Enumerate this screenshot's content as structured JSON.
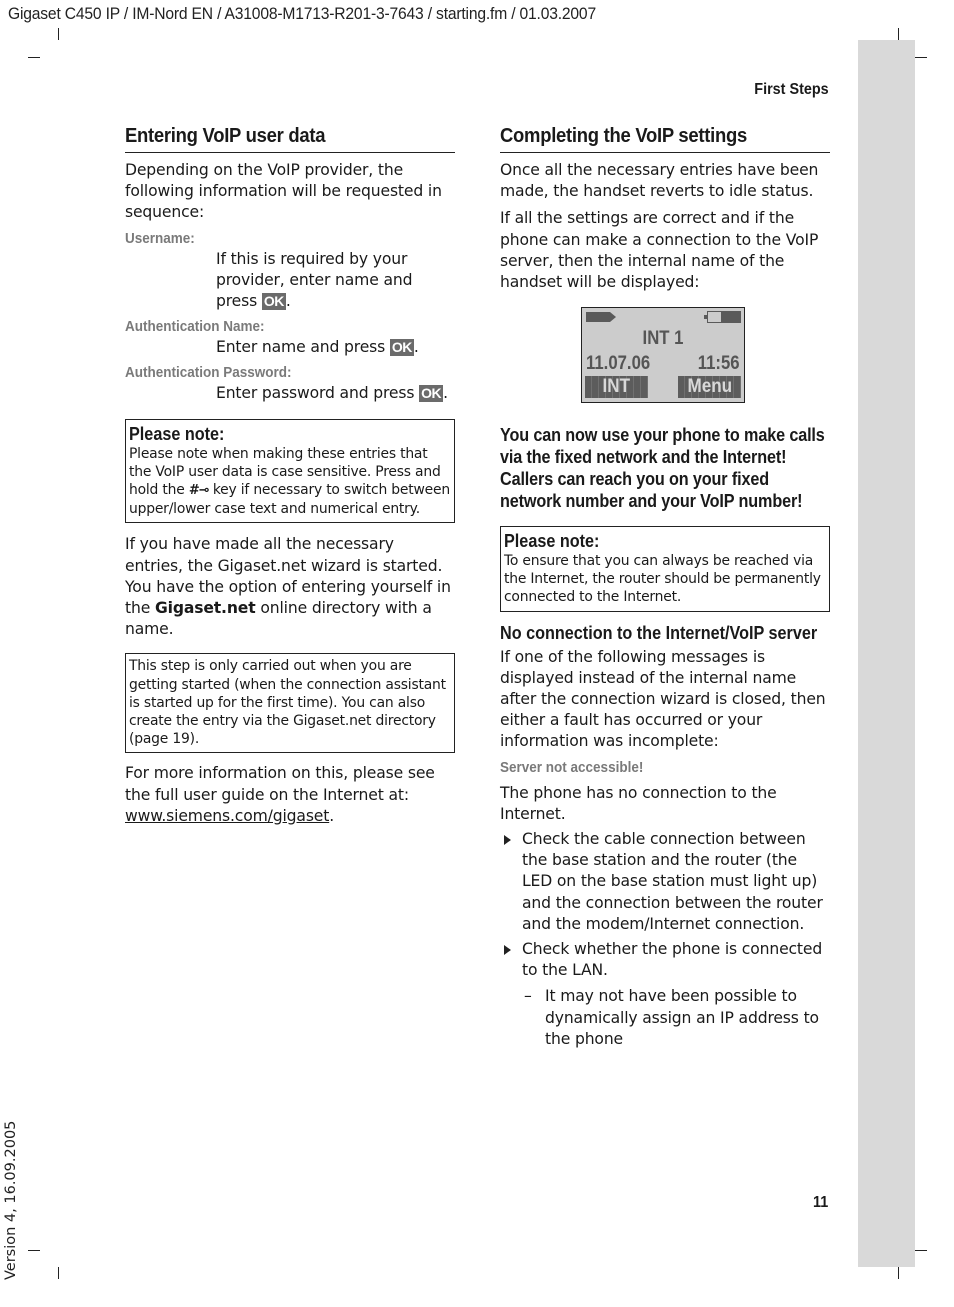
{
  "header": {
    "doc_line": "Gigaset C450 IP / IM-Nord EN / A31008-M1713-R201-3-7643 / starting.fm / 01.03.2007",
    "chapter": "First Steps"
  },
  "footer": {
    "page_number": "11",
    "version": "Version 4, 16.09.2005"
  },
  "left": {
    "title": "Entering VoIP user data",
    "intro": "Depending on the VoIP provider, the following information will be requested in sequence:",
    "entries": [
      {
        "label": "Username:",
        "text": "If this is required by your provider, enter name and press",
        "key": "OK"
      },
      {
        "label": "Authentication Name:",
        "text": "Enter name and press",
        "key": "OK"
      },
      {
        "label": "Authentication Password:",
        "text": "Enter password and press",
        "key": "OK"
      }
    ],
    "note1": {
      "title": "Please note:",
      "text_before_key": "Please note when making these entries that the VoIP user data is case sensitive. Press and hold the",
      "key_symbol": "#⊸",
      "text_after_key": "key if necessary to switch between upper/lower case text and numerical entry."
    },
    "wizard_para_before": "If you have made all the necessary entries, the Gigaset.net wizard is started. You have the option of entering yourself in the",
    "wizard_para_bold": "Gigaset.net",
    "wizard_para_after": "online directory with a name.",
    "note2": "This step is only carried out when you are getting started (when the connection assistant is started up for the first time). You can also create the entry via the Gigaset.net directory (page 19).",
    "more_info": "For more information on this, please see the full user guide on the Internet at:",
    "more_info_link": "www.siemens.com/gigaset",
    "period": "."
  },
  "right": {
    "title": "Completing the VoIP settings",
    "para1": "Once all the necessary entries have been made, the handset reverts to idle status.",
    "para2": "If all the settings are correct and if the phone can make a connection to the VoIP server, then the internal name of the handset will be displayed:",
    "display": {
      "name": "INT 1",
      "date": "11.07.06",
      "time": "11:56",
      "softkey_left": "INT",
      "softkey_right": "Menu",
      "battery_level": 0.6
    },
    "bold_para": "You can now use your phone to make calls via the fixed network and the Internet! Callers can reach you on your fixed network number and your VoIP number!",
    "note": {
      "title": "Please note:",
      "text": "To ensure that you can always be reached via the Internet, the router should be permanently connected to the Internet."
    },
    "subheading": "No connection to the Internet/VoIP server",
    "sub_para": "If one of the following messages is displayed instead of the internal name after the connection wizard is closed, then either a fault has occurred or your information was incomplete:",
    "message_label": "Server not accessible!",
    "message_para": "The phone has no connection to the Internet.",
    "bullets": [
      "Check the cable connection between the base station and the router (the LED on the base station must light up) and the connection between the router and the modem/Internet connection.",
      "Check whether the phone is connected to the LAN."
    ],
    "dash_items": [
      "It may not have been possible to dynamically assign an IP address to the phone"
    ],
    "dash_symbol": "–"
  }
}
